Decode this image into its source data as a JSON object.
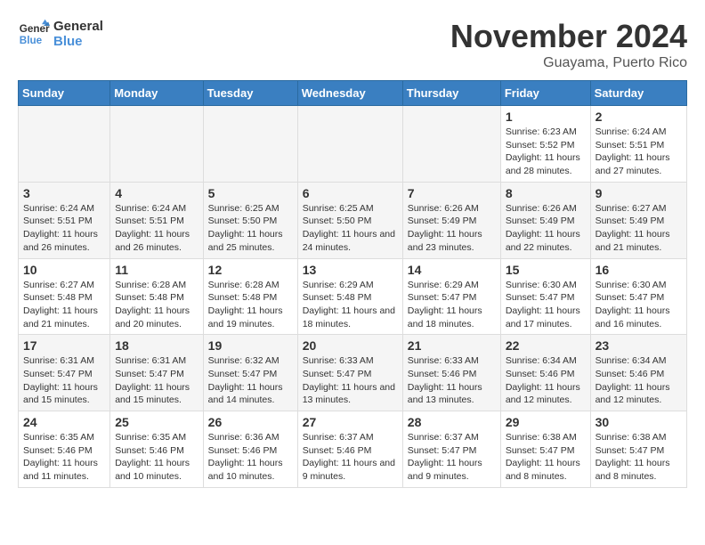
{
  "logo": {
    "line1": "General",
    "line2": "Blue"
  },
  "title": "November 2024",
  "location": "Guayama, Puerto Rico",
  "weekdays": [
    "Sunday",
    "Monday",
    "Tuesday",
    "Wednesday",
    "Thursday",
    "Friday",
    "Saturday"
  ],
  "weeks": [
    [
      {
        "day": "",
        "empty": true
      },
      {
        "day": "",
        "empty": true
      },
      {
        "day": "",
        "empty": true
      },
      {
        "day": "",
        "empty": true
      },
      {
        "day": "",
        "empty": true
      },
      {
        "day": "1",
        "sunrise": "6:23 AM",
        "sunset": "5:52 PM",
        "daylight": "11 hours and 28 minutes."
      },
      {
        "day": "2",
        "sunrise": "6:24 AM",
        "sunset": "5:51 PM",
        "daylight": "11 hours and 27 minutes."
      }
    ],
    [
      {
        "day": "3",
        "sunrise": "6:24 AM",
        "sunset": "5:51 PM",
        "daylight": "11 hours and 26 minutes."
      },
      {
        "day": "4",
        "sunrise": "6:24 AM",
        "sunset": "5:51 PM",
        "daylight": "11 hours and 26 minutes."
      },
      {
        "day": "5",
        "sunrise": "6:25 AM",
        "sunset": "5:50 PM",
        "daylight": "11 hours and 25 minutes."
      },
      {
        "day": "6",
        "sunrise": "6:25 AM",
        "sunset": "5:50 PM",
        "daylight": "11 hours and 24 minutes."
      },
      {
        "day": "7",
        "sunrise": "6:26 AM",
        "sunset": "5:49 PM",
        "daylight": "11 hours and 23 minutes."
      },
      {
        "day": "8",
        "sunrise": "6:26 AM",
        "sunset": "5:49 PM",
        "daylight": "11 hours and 22 minutes."
      },
      {
        "day": "9",
        "sunrise": "6:27 AM",
        "sunset": "5:49 PM",
        "daylight": "11 hours and 21 minutes."
      }
    ],
    [
      {
        "day": "10",
        "sunrise": "6:27 AM",
        "sunset": "5:48 PM",
        "daylight": "11 hours and 21 minutes."
      },
      {
        "day": "11",
        "sunrise": "6:28 AM",
        "sunset": "5:48 PM",
        "daylight": "11 hours and 20 minutes."
      },
      {
        "day": "12",
        "sunrise": "6:28 AM",
        "sunset": "5:48 PM",
        "daylight": "11 hours and 19 minutes."
      },
      {
        "day": "13",
        "sunrise": "6:29 AM",
        "sunset": "5:48 PM",
        "daylight": "11 hours and 18 minutes."
      },
      {
        "day": "14",
        "sunrise": "6:29 AM",
        "sunset": "5:47 PM",
        "daylight": "11 hours and 18 minutes."
      },
      {
        "day": "15",
        "sunrise": "6:30 AM",
        "sunset": "5:47 PM",
        "daylight": "11 hours and 17 minutes."
      },
      {
        "day": "16",
        "sunrise": "6:30 AM",
        "sunset": "5:47 PM",
        "daylight": "11 hours and 16 minutes."
      }
    ],
    [
      {
        "day": "17",
        "sunrise": "6:31 AM",
        "sunset": "5:47 PM",
        "daylight": "11 hours and 15 minutes."
      },
      {
        "day": "18",
        "sunrise": "6:31 AM",
        "sunset": "5:47 PM",
        "daylight": "11 hours and 15 minutes."
      },
      {
        "day": "19",
        "sunrise": "6:32 AM",
        "sunset": "5:47 PM",
        "daylight": "11 hours and 14 minutes."
      },
      {
        "day": "20",
        "sunrise": "6:33 AM",
        "sunset": "5:47 PM",
        "daylight": "11 hours and 13 minutes."
      },
      {
        "day": "21",
        "sunrise": "6:33 AM",
        "sunset": "5:46 PM",
        "daylight": "11 hours and 13 minutes."
      },
      {
        "day": "22",
        "sunrise": "6:34 AM",
        "sunset": "5:46 PM",
        "daylight": "11 hours and 12 minutes."
      },
      {
        "day": "23",
        "sunrise": "6:34 AM",
        "sunset": "5:46 PM",
        "daylight": "11 hours and 12 minutes."
      }
    ],
    [
      {
        "day": "24",
        "sunrise": "6:35 AM",
        "sunset": "5:46 PM",
        "daylight": "11 hours and 11 minutes."
      },
      {
        "day": "25",
        "sunrise": "6:35 AM",
        "sunset": "5:46 PM",
        "daylight": "11 hours and 10 minutes."
      },
      {
        "day": "26",
        "sunrise": "6:36 AM",
        "sunset": "5:46 PM",
        "daylight": "11 hours and 10 minutes."
      },
      {
        "day": "27",
        "sunrise": "6:37 AM",
        "sunset": "5:46 PM",
        "daylight": "11 hours and 9 minutes."
      },
      {
        "day": "28",
        "sunrise": "6:37 AM",
        "sunset": "5:47 PM",
        "daylight": "11 hours and 9 minutes."
      },
      {
        "day": "29",
        "sunrise": "6:38 AM",
        "sunset": "5:47 PM",
        "daylight": "11 hours and 8 minutes."
      },
      {
        "day": "30",
        "sunrise": "6:38 AM",
        "sunset": "5:47 PM",
        "daylight": "11 hours and 8 minutes."
      }
    ]
  ],
  "labels": {
    "sunrise": "Sunrise:",
    "sunset": "Sunset:",
    "daylight": "Daylight:"
  }
}
